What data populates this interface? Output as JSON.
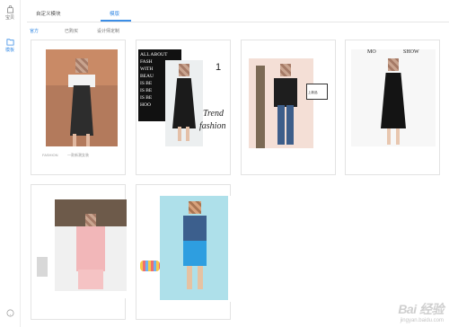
{
  "rail": {
    "items": [
      {
        "label": "宝贝"
      },
      {
        "label": "模板"
      }
    ]
  },
  "tabs": [
    {
      "label": "自定义模块"
    },
    {
      "label": "模版"
    }
  ],
  "subfilters": [
    {
      "label": "官方"
    },
    {
      "label": "已购买"
    },
    {
      "label": "设计师定制"
    }
  ],
  "cards": {
    "c1": {
      "caption1": "FASHION",
      "caption2": "一款新潮女装"
    },
    "c2": {
      "lines": [
        "ALL ABOUT",
        "FASH",
        "WITH",
        "BEAU",
        "IS BE",
        "IS BE",
        "IS BE",
        "HOO"
      ],
      "big1": "Trend",
      "big2": "fashion",
      "num": "1"
    },
    "c3": {
      "label": "上新品"
    },
    "c4": {
      "brand_left": "MO",
      "brand_right": "SHOW"
    }
  },
  "watermark": {
    "brand": "Bai 经验",
    "url": "jingyan.baidu.com"
  },
  "colors": {
    "accent": "#3c8ee6"
  }
}
